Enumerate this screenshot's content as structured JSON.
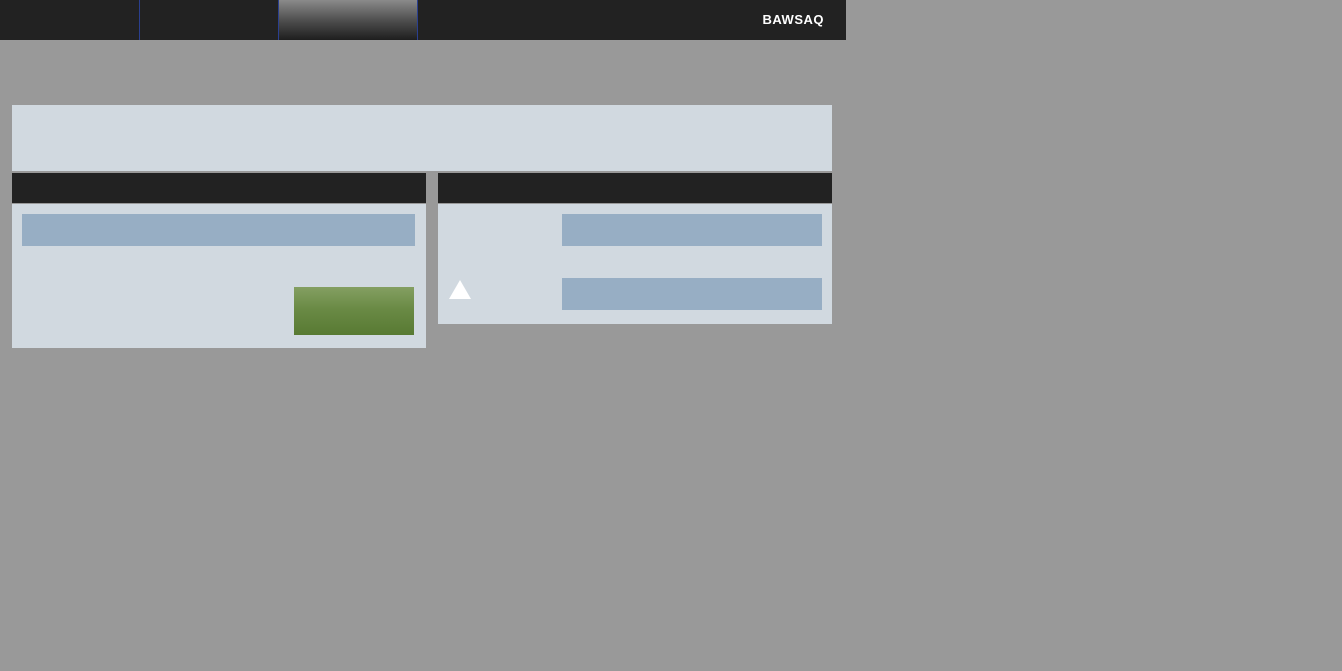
{
  "header": {
    "logo_text": "BAWSAQ",
    "tabs": [
      {
        "label": "",
        "active": false
      },
      {
        "label": "",
        "active": false
      },
      {
        "label": "",
        "active": true
      }
    ]
  },
  "banner": {
    "text": ""
  },
  "left_panel": {
    "title": "",
    "input_value": "",
    "submit_label": ""
  },
  "right_panel": {
    "title": "",
    "field1_value": "",
    "field2_value": "",
    "warning_icon": "warning-triangle-icon"
  },
  "colors": {
    "background": "#999999",
    "header": "#222222",
    "panel": "#d1d9e0",
    "field": "#97aec4",
    "button": "#6a8a45",
    "tab_divider": "#2a3f8f"
  }
}
